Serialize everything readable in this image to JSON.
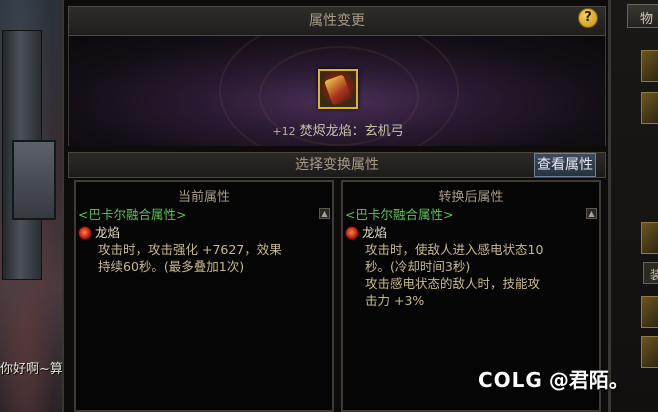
{
  "background": {
    "chat_text": "你好啊~算",
    "right_tab_label": "物",
    "right_tab2_label": "装"
  },
  "window": {
    "title": "属性变更",
    "item": {
      "enhance_level": "+12",
      "name": "焚烬龙焰：玄机弓"
    },
    "select_bar_title": "选择变换属性",
    "view_button_label": "查看属性"
  },
  "current_panel": {
    "title": "当前属性",
    "category": "<巴卡尔融合属性>",
    "skill_name": "龙焰",
    "description_lines": [
      "攻击时，攻击强化 +7627，效果",
      "持续60秒。(最多叠加1次)"
    ]
  },
  "converted_panel": {
    "title": "转换后属性",
    "category": "<巴卡尔融合属性>",
    "skill_name": "龙焰",
    "description_lines": [
      "攻击时，使敌人进入感电状态10",
      "秒。(冷却时间3秒)",
      "攻击感电状态的敌人时，技能攻",
      "击力 +3%"
    ]
  },
  "watermark": {
    "logo": "COLG",
    "author": "@君陌。"
  },
  "colors": {
    "category_green": "#5ec25a",
    "desc_gold": "#c7b98f",
    "title_gray": "#a69c86",
    "item_border_gold": "#d9b23a"
  },
  "icons": {
    "help": "help-question-icon",
    "flame": "dragon-flame-icon",
    "scroll": "scroll-up-icon"
  }
}
